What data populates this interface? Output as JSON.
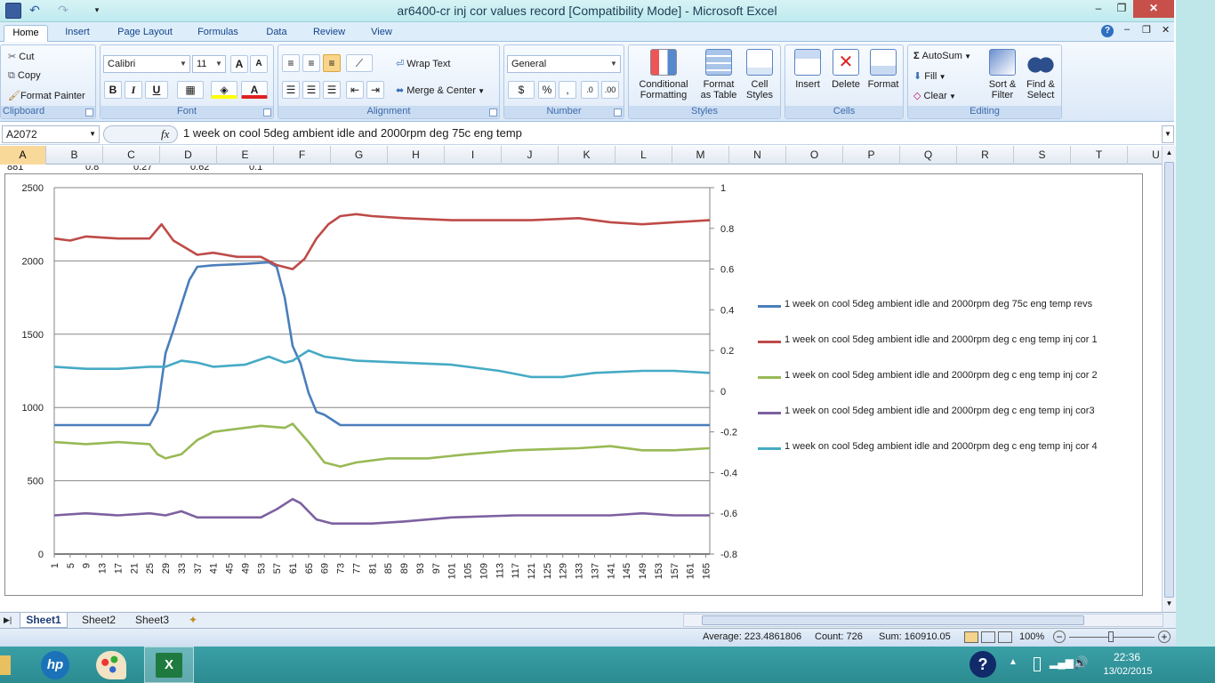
{
  "window": {
    "title": "ar6400-cr inj cor values record  [Compatibility Mode] - Microsoft Excel"
  },
  "tabs": [
    "Home",
    "Insert",
    "Page Layout",
    "Formulas",
    "Data",
    "Review",
    "View"
  ],
  "ribbon": {
    "clipboard": {
      "label": "Clipboard",
      "cut": "Cut",
      "copy": "Copy",
      "format_painter": "Format Painter"
    },
    "font": {
      "label": "Font",
      "name": "Calibri",
      "size": "11",
      "bold": "B",
      "italic": "I",
      "underline": "U"
    },
    "alignment": {
      "label": "Alignment",
      "wrap": "Wrap Text",
      "merge": "Merge & Center"
    },
    "number": {
      "label": "Number",
      "format": "General"
    },
    "styles": {
      "label": "Styles",
      "conditional": [
        "Conditional",
        "Formatting"
      ],
      "format_table": [
        "Format",
        "as Table"
      ],
      "cell_styles": [
        "Cell",
        "Styles"
      ]
    },
    "cells": {
      "label": "Cells",
      "insert": "Insert",
      "delete": "Delete",
      "format": "Format"
    },
    "editing": {
      "label": "Editing",
      "autosum": "AutoSum",
      "fill": "Fill",
      "clear": "Clear",
      "sort": [
        "Sort &",
        "Filter"
      ],
      "find": [
        "Find &",
        "Select"
      ]
    }
  },
  "formula_bar": {
    "name_box": "A2072",
    "fx": "fx",
    "formula": "1 week on  cool   5deg ambient idle and 2000rpm deg 75c eng temp"
  },
  "columns": [
    "A",
    "B",
    "C",
    "D",
    "E",
    "F",
    "G",
    "H",
    "I",
    "J",
    "K",
    "L",
    "M",
    "N",
    "O",
    "P",
    "Q",
    "R",
    "S",
    "T",
    "U"
  ],
  "partial_row": [
    "881",
    "0.8",
    "0.27",
    "0.62",
    "0.1"
  ],
  "sheets": [
    "Sheet1",
    "Sheet2",
    "Sheet3"
  ],
  "status": {
    "average": "Average: 223.4861806",
    "count": "Count: 726",
    "sum": "Sum: 160910.05",
    "zoom": "100%"
  },
  "taskbar": {
    "time": "22:36",
    "date": "13/02/2015"
  },
  "colors": {
    "revs": "#4a7ebb",
    "cor1": "#be4b48",
    "cor2": "#98b954",
    "cor3": "#7d60a0",
    "cor4": "#46aac5"
  },
  "chart_data": {
    "type": "line",
    "x_tick_labels": [
      "1",
      "5",
      "9",
      "13",
      "17",
      "21",
      "25",
      "29",
      "33",
      "37",
      "41",
      "45",
      "49",
      "53",
      "57",
      "61",
      "65",
      "69",
      "73",
      "77",
      "81",
      "85",
      "89",
      "93",
      "97",
      "101",
      "105",
      "109",
      "113",
      "117",
      "121",
      "125",
      "129",
      "133",
      "137",
      "141",
      "145",
      "149",
      "153",
      "157",
      "161",
      "165"
    ],
    "y_left_ticks": [
      "0",
      "500",
      "1000",
      "1500",
      "2000",
      "2500"
    ],
    "y_right_ticks": [
      "-0.8",
      "-0.6",
      "-0.4",
      "-0.2",
      "0",
      "0.2",
      "0.4",
      "0.6",
      "0.8",
      "1"
    ],
    "ylim_left": [
      0,
      2500
    ],
    "ylim_right": [
      -0.8,
      1
    ],
    "x_range": [
      1,
      166
    ],
    "gridlines": "horizontal",
    "legend_position": "right",
    "series": [
      {
        "name": "1 week on  cool   5deg ambient idle and 2000rpm deg 75c eng temp revs",
        "axis": "left",
        "color_key": "revs",
        "points": [
          [
            1,
            880
          ],
          [
            10,
            880
          ],
          [
            25,
            880
          ],
          [
            27,
            980
          ],
          [
            29,
            1370
          ],
          [
            31,
            1530
          ],
          [
            33,
            1700
          ],
          [
            35,
            1870
          ],
          [
            37,
            1960
          ],
          [
            41,
            1970
          ],
          [
            49,
            1980
          ],
          [
            55,
            1990
          ],
          [
            57,
            1960
          ],
          [
            59,
            1750
          ],
          [
            61,
            1420
          ],
          [
            63,
            1300
          ],
          [
            65,
            1100
          ],
          [
            67,
            970
          ],
          [
            69,
            950
          ],
          [
            73,
            880
          ],
          [
            100,
            880
          ],
          [
            130,
            880
          ],
          [
            160,
            880
          ],
          [
            166,
            880
          ]
        ]
      },
      {
        "name": "1 week on  cool   5deg ambient idle and 2000rpm deg c eng temp inj cor 1",
        "axis": "right",
        "color_key": "cor1",
        "points": [
          [
            1,
            0.75
          ],
          [
            5,
            0.74
          ],
          [
            9,
            0.76
          ],
          [
            17,
            0.75
          ],
          [
            25,
            0.75
          ],
          [
            28,
            0.82
          ],
          [
            31,
            0.74
          ],
          [
            37,
            0.67
          ],
          [
            41,
            0.68
          ],
          [
            47,
            0.66
          ],
          [
            53,
            0.66
          ],
          [
            57,
            0.62
          ],
          [
            61,
            0.6
          ],
          [
            64,
            0.65
          ],
          [
            67,
            0.75
          ],
          [
            70,
            0.82
          ],
          [
            73,
            0.86
          ],
          [
            77,
            0.87
          ],
          [
            81,
            0.86
          ],
          [
            89,
            0.85
          ],
          [
            101,
            0.84
          ],
          [
            113,
            0.84
          ],
          [
            121,
            0.84
          ],
          [
            133,
            0.85
          ],
          [
            141,
            0.83
          ],
          [
            149,
            0.82
          ],
          [
            157,
            0.83
          ],
          [
            166,
            0.84
          ]
        ]
      },
      {
        "name": "1 week on  cool   5deg ambient idle and 2000rpm deg c eng temp inj cor 2",
        "axis": "right",
        "color_key": "cor2",
        "points": [
          [
            1,
            -0.25
          ],
          [
            9,
            -0.26
          ],
          [
            17,
            -0.25
          ],
          [
            25,
            -0.26
          ],
          [
            27,
            -0.31
          ],
          [
            29,
            -0.33
          ],
          [
            33,
            -0.31
          ],
          [
            37,
            -0.24
          ],
          [
            41,
            -0.2
          ],
          [
            49,
            -0.18
          ],
          [
            53,
            -0.17
          ],
          [
            59,
            -0.18
          ],
          [
            61,
            -0.16
          ],
          [
            65,
            -0.25
          ],
          [
            69,
            -0.35
          ],
          [
            73,
            -0.37
          ],
          [
            77,
            -0.35
          ],
          [
            85,
            -0.33
          ],
          [
            95,
            -0.33
          ],
          [
            105,
            -0.31
          ],
          [
            117,
            -0.29
          ],
          [
            133,
            -0.28
          ],
          [
            141,
            -0.27
          ],
          [
            149,
            -0.29
          ],
          [
            157,
            -0.29
          ],
          [
            166,
            -0.28
          ]
        ]
      },
      {
        "name": "1 week on  cool   5deg ambient idle and 2000rpm deg c eng temp inj cor3",
        "axis": "right",
        "color_key": "cor3",
        "points": [
          [
            1,
            -0.61
          ],
          [
            9,
            -0.6
          ],
          [
            17,
            -0.61
          ],
          [
            25,
            -0.6
          ],
          [
            29,
            -0.61
          ],
          [
            33,
            -0.59
          ],
          [
            37,
            -0.62
          ],
          [
            45,
            -0.62
          ],
          [
            53,
            -0.62
          ],
          [
            57,
            -0.58
          ],
          [
            61,
            -0.53
          ],
          [
            63,
            -0.55
          ],
          [
            67,
            -0.63
          ],
          [
            71,
            -0.65
          ],
          [
            81,
            -0.65
          ],
          [
            89,
            -0.64
          ],
          [
            101,
            -0.62
          ],
          [
            117,
            -0.61
          ],
          [
            125,
            -0.61
          ],
          [
            141,
            -0.61
          ],
          [
            149,
            -0.6
          ],
          [
            157,
            -0.61
          ],
          [
            166,
            -0.61
          ]
        ]
      },
      {
        "name": "1 week on  cool   5deg ambient idle and 2000rpm deg c eng temp inj cor 4",
        "axis": "right",
        "color_key": "cor4",
        "points": [
          [
            1,
            0.12
          ],
          [
            9,
            0.11
          ],
          [
            17,
            0.11
          ],
          [
            25,
            0.12
          ],
          [
            29,
            0.12
          ],
          [
            33,
            0.15
          ],
          [
            37,
            0.14
          ],
          [
            41,
            0.12
          ],
          [
            49,
            0.13
          ],
          [
            55,
            0.17
          ],
          [
            59,
            0.14
          ],
          [
            61,
            0.15
          ],
          [
            65,
            0.2
          ],
          [
            69,
            0.17
          ],
          [
            77,
            0.15
          ],
          [
            89,
            0.14
          ],
          [
            101,
            0.13
          ],
          [
            113,
            0.1
          ],
          [
            121,
            0.07
          ],
          [
            129,
            0.07
          ],
          [
            137,
            0.09
          ],
          [
            149,
            0.1
          ],
          [
            157,
            0.1
          ],
          [
            166,
            0.09
          ]
        ]
      }
    ]
  }
}
